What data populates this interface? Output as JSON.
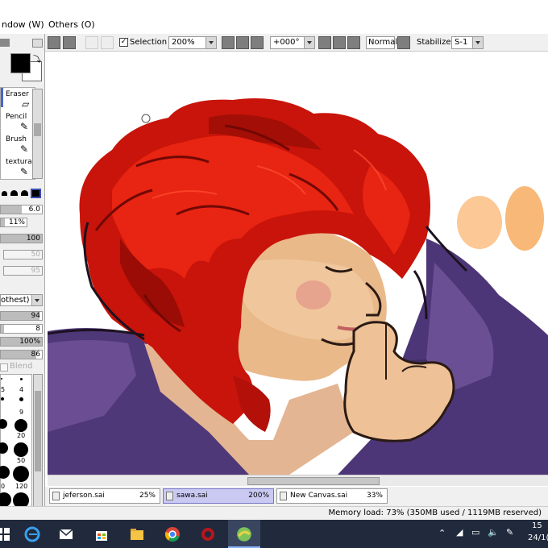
{
  "menubar": {
    "items": [
      "ndow (W)",
      "Others (O)"
    ]
  },
  "toolbar": {
    "selection_label": "Selection",
    "selection_checked": true,
    "zoom_value": "200%",
    "rotation_value": "+000°",
    "blend_mode": "Normal",
    "stabilizer_label": "Stabilizer",
    "stabilizer_value": "S-1"
  },
  "left_panel": {
    "tools": [
      "Eraser",
      "Pencil",
      "Brush",
      "textura"
    ],
    "brush_size": "6.0",
    "min_size": "11%",
    "density": "100",
    "disabled_values": [
      "50",
      "95"
    ],
    "texture_mode": "othest)",
    "values": [
      "94",
      "8",
      "100%",
      "86"
    ],
    "blend_label": "Blend",
    "dot_labels": [
      "4",
      "9",
      "20",
      "50",
      "120",
      "0"
    ]
  },
  "colors": {
    "ui_bg": "#f0f0f0",
    "active_tab": "#c9c9f2",
    "taskbar": "#202a3c",
    "hair_red": "#d81a0a",
    "cloth_purple": "#5a3f80",
    "skin": "#e8b07a"
  },
  "tabs": [
    {
      "name": "jeferson.sai",
      "zoom": "25%"
    },
    {
      "name": "sawa.sai",
      "zoom": "200%"
    },
    {
      "name": "New Canvas.sai",
      "zoom": "33%"
    }
  ],
  "status": {
    "memory": "Memory load: 73% (350MB used / 1119MB reserved)"
  },
  "taskbar": {
    "time": "15",
    "date": "24/1("
  }
}
